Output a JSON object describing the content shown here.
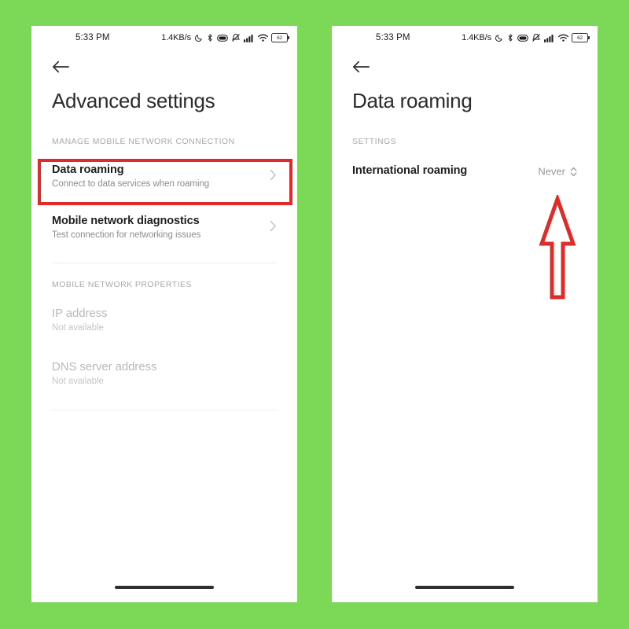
{
  "meta": {
    "background_color": "#7CD857",
    "annotation_color": "#E02B2B",
    "panel_background": "#FFFFFF"
  },
  "status_bar": {
    "time": "5:33 PM",
    "network_speed": "1.4KB/s",
    "battery_level": "62",
    "icons": [
      "do-not-disturb-moon-icon",
      "bluetooth-icon",
      "vpn-icon",
      "mute-vibrate-icon",
      "cellular-signal-icon",
      "wifi-icon",
      "battery-icon"
    ]
  },
  "screens": [
    {
      "id": "advanced-settings",
      "nav": {
        "back_icon": "back-arrow-icon"
      },
      "title": "Advanced settings",
      "sections": [
        {
          "label": "MANAGE MOBILE NETWORK CONNECTION",
          "rows": [
            {
              "title": "Data roaming",
              "subtitle": "Connect to data services when roaming",
              "chevron": "chevron-right-icon",
              "highlighted": true
            },
            {
              "title": "Mobile network diagnostics",
              "subtitle": "Test connection for networking issues",
              "chevron": "chevron-right-icon",
              "highlighted": false
            }
          ]
        },
        {
          "label": "MOBILE NETWORK PROPERTIES",
          "rows": [
            {
              "title": "IP address",
              "subtitle": "Not available",
              "disabled": true
            },
            {
              "title": "DNS server address",
              "subtitle": "Not available",
              "disabled": true
            }
          ]
        }
      ]
    },
    {
      "id": "data-roaming",
      "nav": {
        "back_icon": "back-arrow-icon"
      },
      "title": "Data roaming",
      "sections": [
        {
          "label": "SETTINGS",
          "rows": [
            {
              "title": "International roaming",
              "value": "Never",
              "value_icon": "up-down-chevron-icon"
            }
          ]
        }
      ]
    }
  ],
  "annotations": [
    {
      "type": "highlight-box",
      "target": "Data roaming",
      "color": "#E02B2B"
    },
    {
      "type": "arrow-up",
      "target": "Never",
      "color": "#E02B2B"
    }
  ]
}
